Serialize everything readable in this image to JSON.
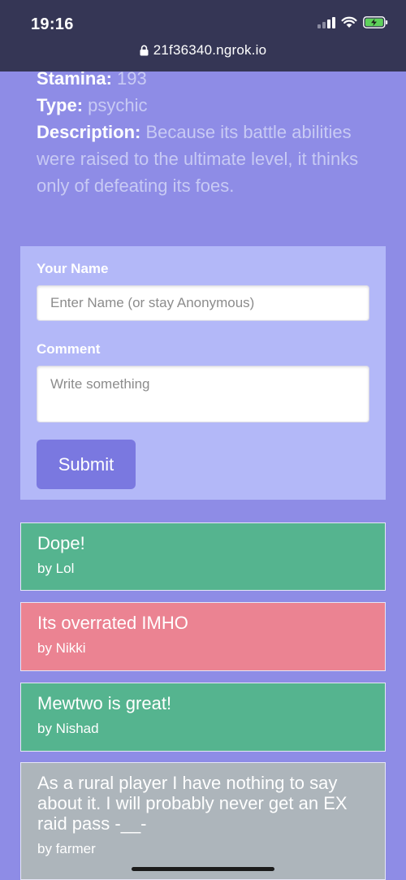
{
  "status_bar": {
    "time": "19:16"
  },
  "browser": {
    "url": "21f36340.ngrok.io"
  },
  "details": {
    "stamina_label": "Stamina:",
    "stamina_value": "193",
    "type_label": "Type:",
    "type_value": "psychic",
    "description_label": "Description:",
    "description_value": "Because its battle abilities were raised to the ultimate level, it thinks only of defeating its foes."
  },
  "form": {
    "name_label": "Your Name",
    "name_placeholder": "Enter Name (or stay Anonymous)",
    "comment_label": "Comment",
    "comment_placeholder": "Write something",
    "submit_label": "Submit"
  },
  "comments": [
    {
      "text": "Dope!",
      "by": "by Lol",
      "color": "#55b48f"
    },
    {
      "text": "Its overrated IMHO",
      "by": "by Nikki",
      "color": "#eb8392"
    },
    {
      "text": "Mewtwo is great!",
      "by": "by Nishad",
      "color": "#55b48f"
    },
    {
      "text": "As a rural player I have nothing to say about it. I will probably never get an EX raid pass -__-",
      "by": "by farmer",
      "color": "#adb5bb"
    }
  ]
}
